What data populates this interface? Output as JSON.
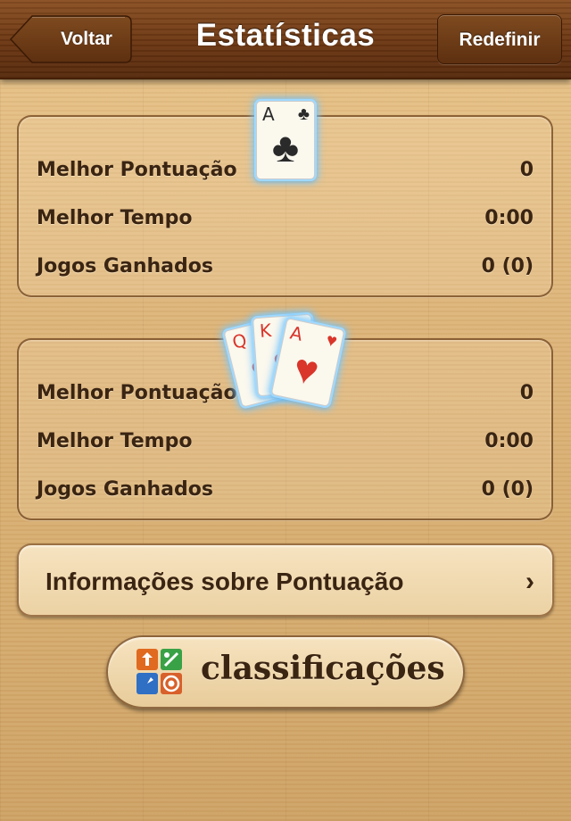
{
  "header": {
    "title": "Estatísticas",
    "back_label": "Voltar",
    "reset_label": "Redefinir"
  },
  "panels": [
    {
      "card_icon": "single-ace-of-clubs-icon",
      "card": {
        "rank": "A",
        "suit": "♣"
      },
      "rows": [
        {
          "label": "Melhor Pontuação",
          "value": "0"
        },
        {
          "label": "Melhor Tempo",
          "value": "0:00"
        },
        {
          "label": "Jogos Ganhados",
          "value": "0 (0)"
        }
      ]
    },
    {
      "card_icon": "three-card-fan-hearts-icon",
      "cards": [
        {
          "rank": "Q",
          "suit": "♥"
        },
        {
          "rank": "K",
          "suit": "♥"
        },
        {
          "rank": "A",
          "suit": "♥"
        }
      ],
      "rows": [
        {
          "label": "Melhor Pontuação",
          "value": "0"
        },
        {
          "label": "Melhor Tempo",
          "value": "0:00"
        },
        {
          "label": "Jogos Ganhados",
          "value": "0 (0)"
        }
      ]
    }
  ],
  "info_button": {
    "label": "Informações sobre Pontuação",
    "chevron": "›"
  },
  "leaderboard_button": {
    "label": "classificações",
    "icon": "game-center-icon"
  },
  "colors": {
    "navbar": "#6b3612",
    "wood": "#ddb57a",
    "text": "#3a2412",
    "card_glow": "#9fd9ff",
    "heart_red": "#d9352a"
  }
}
